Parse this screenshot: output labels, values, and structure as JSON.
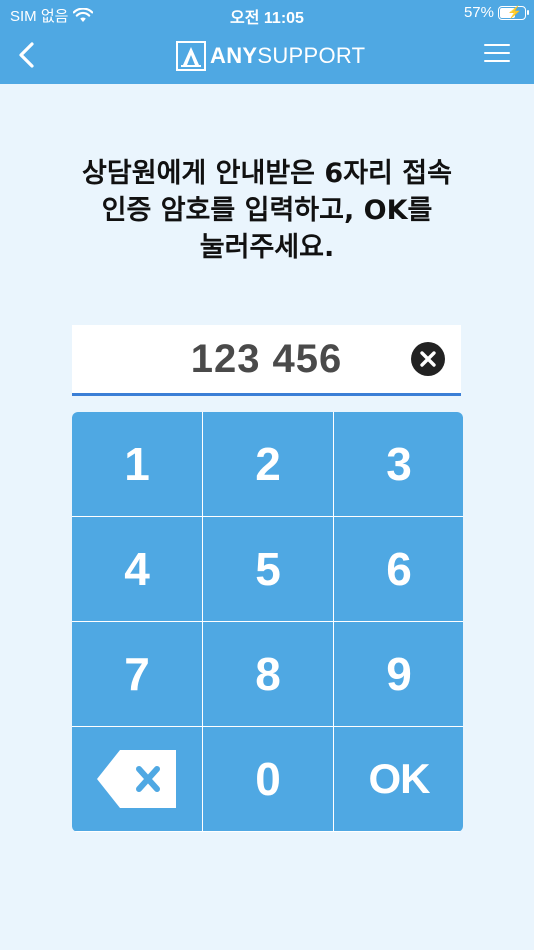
{
  "status_bar": {
    "carrier": "SIM 없음",
    "time": "오전 11:05",
    "battery_percent": "57%"
  },
  "nav": {
    "logo_text_bold": "ANY",
    "logo_text_regular": "SUPPORT"
  },
  "instruction": {
    "line1": "상담원에게 안내받은 6자리 접속",
    "line2": "인증 암호를 입력하고, OK를",
    "line3": "눌러주세요."
  },
  "code_input": {
    "value": "123 456"
  },
  "keypad": {
    "keys": [
      "1",
      "2",
      "3",
      "4",
      "5",
      "6",
      "7",
      "8",
      "9",
      "0"
    ],
    "ok_label": "OK"
  },
  "colors": {
    "primary": "#4fa8e3",
    "background": "#eaf5fd",
    "input_underline": "#3b7fd6"
  }
}
